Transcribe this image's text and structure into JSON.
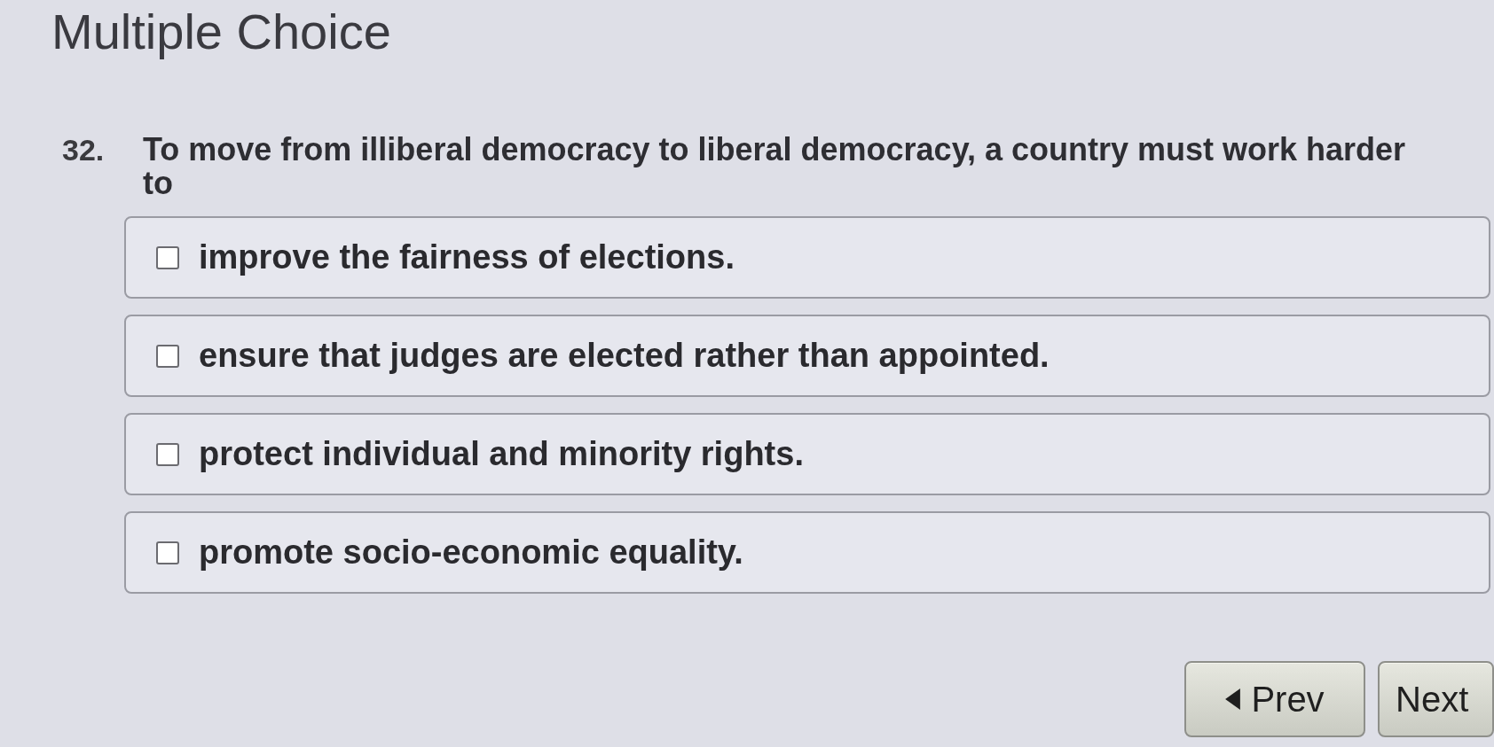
{
  "heading": "Multiple Choice",
  "question": {
    "number": "32.",
    "text": "To move from illiberal democracy to liberal democracy, a country must work harder to"
  },
  "options": [
    {
      "label": "improve the fairness of elections.",
      "checked": false
    },
    {
      "label": "ensure that judges are elected rather than appointed.",
      "checked": false
    },
    {
      "label": "protect individual and minority rights.",
      "checked": false
    },
    {
      "label": "promote socio-economic equality.",
      "checked": false
    }
  ],
  "buttons": [
    {
      "kind": "prev",
      "label": "Prev"
    },
    {
      "kind": "next",
      "label": "Next"
    }
  ]
}
